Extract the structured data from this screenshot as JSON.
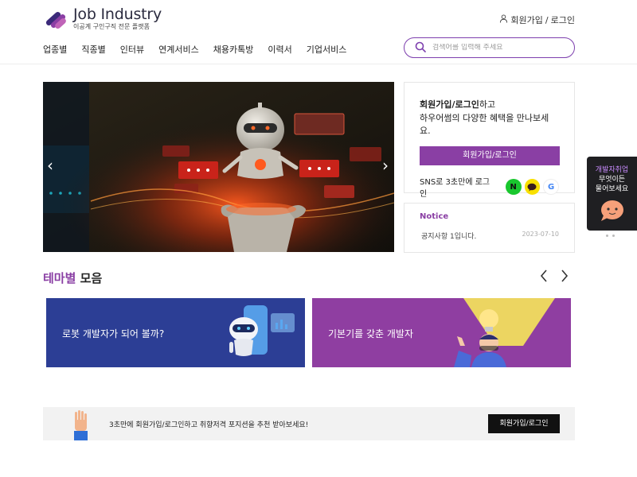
{
  "header": {
    "logo_title": "Job Industry",
    "logo_subtitle": "이공계 구인구직 전문 플랫폼",
    "auth_signup": "회원가입",
    "auth_sep": "/",
    "auth_login": "로그인"
  },
  "nav": {
    "items": [
      "업종별",
      "직종별",
      "인터뷰",
      "연계서비스",
      "채용카톡방",
      "이력서",
      "기업서비스"
    ]
  },
  "search": {
    "placeholder": "검색어를 입력해 주세요"
  },
  "login_box": {
    "msg_bold": "회원가입/로그인",
    "msg_suffix": "하고",
    "msg_line2": "하우어썸의 다양한 혜택을 만나보세요.",
    "button_label": "회원가입/로그인",
    "sns_label": "SNS로 3초만에 로그인",
    "sns_naver": "N",
    "sns_google": "G"
  },
  "notice": {
    "title": "Notice",
    "item_text": "공지사항 1입니다.",
    "item_date": "2023-07-10"
  },
  "side_widget": {
    "line1": "개발자취업",
    "line2": "무엇이든",
    "line3": "물어보세요"
  },
  "theme": {
    "title_accent": "테마별",
    "title_rest": "모음",
    "cards": [
      {
        "label": "로봇 개발자가 되어 볼까?"
      },
      {
        "label": "기본기를 갖춘 개발자"
      }
    ]
  },
  "banner": {
    "prev": "‹",
    "next": "›"
  },
  "bottom_strip": {
    "text": "3초만에 회원가입/로그인하고 취향저격 포지션을 추천 받아보세요!",
    "button_label": "회원가입/로그인"
  },
  "colors": {
    "brand_purple": "#8a3fa4",
    "card1_bg": "#2c3e95",
    "card2_bg": "#8f3ea1"
  }
}
